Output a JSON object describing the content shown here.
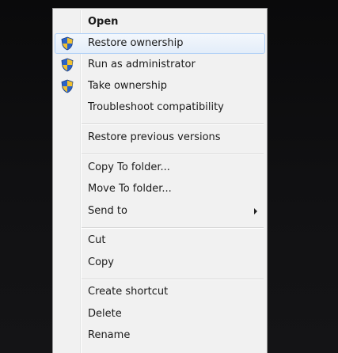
{
  "menu": {
    "items": [
      {
        "label": "Open"
      },
      {
        "label": "Restore ownership",
        "icon": "uac-shield-icon"
      },
      {
        "label": "Run as administrator",
        "icon": "uac-shield-icon"
      },
      {
        "label": "Take ownership",
        "icon": "uac-shield-icon"
      },
      {
        "label": "Troubleshoot compatibility"
      },
      {
        "label": "Restore previous versions"
      },
      {
        "label": "Copy To folder..."
      },
      {
        "label": "Move To folder..."
      },
      {
        "label": "Send to",
        "submenu_icon": "chevron-right-icon"
      },
      {
        "label": "Cut"
      },
      {
        "label": "Copy"
      },
      {
        "label": "Create shortcut"
      },
      {
        "label": "Delete"
      },
      {
        "label": "Rename"
      }
    ]
  },
  "colors": {
    "menu_background": "#f1f1f1",
    "hover_border": "#aecff7",
    "hover_fill": "#e3edf9",
    "shield_blue": "#2b63c7",
    "shield_yellow": "#f2c12e"
  }
}
